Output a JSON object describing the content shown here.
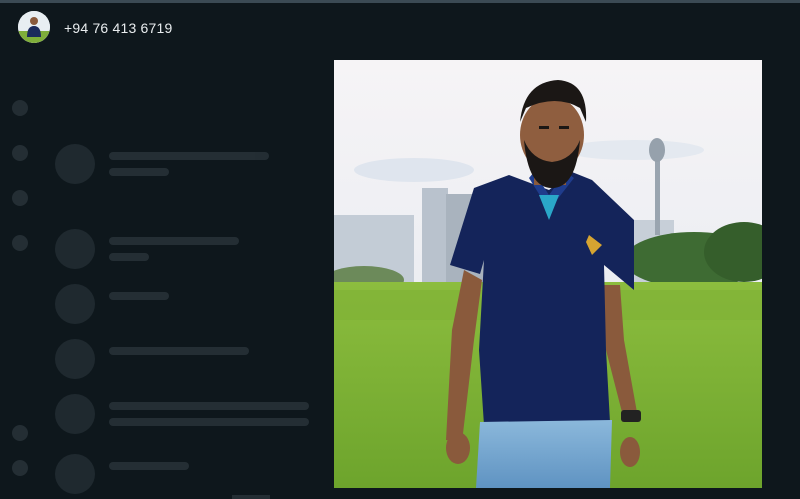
{
  "header": {
    "title": "+94 76 413 6719",
    "avatar_icon": "profile-photo-icon"
  },
  "colors": {
    "background": "#0e171c",
    "text": "#e9edef"
  }
}
